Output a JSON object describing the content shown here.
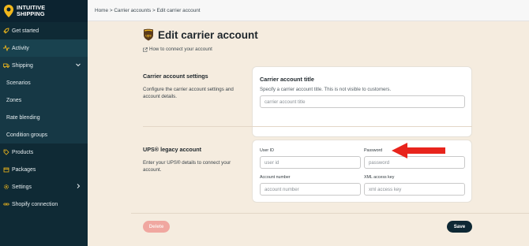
{
  "brand": {
    "line1": "INTUITIVE",
    "line2": "SHIPPING"
  },
  "sidebar": {
    "items": [
      {
        "label": "Get started",
        "icon": "rocket-icon"
      },
      {
        "label": "Activity",
        "icon": "activity-icon"
      },
      {
        "label": "Shipping",
        "icon": "truck-icon"
      },
      {
        "label": "Scenarios"
      },
      {
        "label": "Zones"
      },
      {
        "label": "Rate blending"
      },
      {
        "label": "Condition groups"
      },
      {
        "label": "Products",
        "icon": "tag-icon"
      },
      {
        "label": "Packages",
        "icon": "box-icon"
      },
      {
        "label": "Settings",
        "icon": "gear-icon"
      },
      {
        "label": "Shopify connection",
        "icon": "link-icon"
      }
    ]
  },
  "breadcrumb": "Home > Carrier accounts > Edit carrier account",
  "page": {
    "title": "Edit carrier account",
    "help_link": "How to connect your account"
  },
  "settings_section": {
    "title": "Carrier account settings",
    "description": "Configure the carrier account settings and account details.",
    "card_title": "Carrier account title",
    "card_description": "Specify a carrier account title. This is not visible to customers.",
    "title_placeholder": "carrier account title"
  },
  "ups_section": {
    "title": "UPS® legacy account",
    "description": "Enter your UPS® details to connect your account.",
    "user_id_label": "User ID",
    "user_id_placeholder": "user id",
    "password_label": "Password",
    "password_placeholder": "password",
    "account_number_label": "Account number",
    "account_number_placeholder": "account number",
    "xml_key_label": "XML access key",
    "xml_key_placeholder": "xml access key"
  },
  "actions": {
    "delete_label": "Delete",
    "save_label": "Save"
  },
  "colors": {
    "sidebar_bg": "#0f2a35",
    "accent_yellow": "#f1b81c",
    "page_bg": "#f5ecdf",
    "delete_bg": "#f0a7a0",
    "save_bg": "#0e2834",
    "annotation_arrow": "#e8241c"
  }
}
